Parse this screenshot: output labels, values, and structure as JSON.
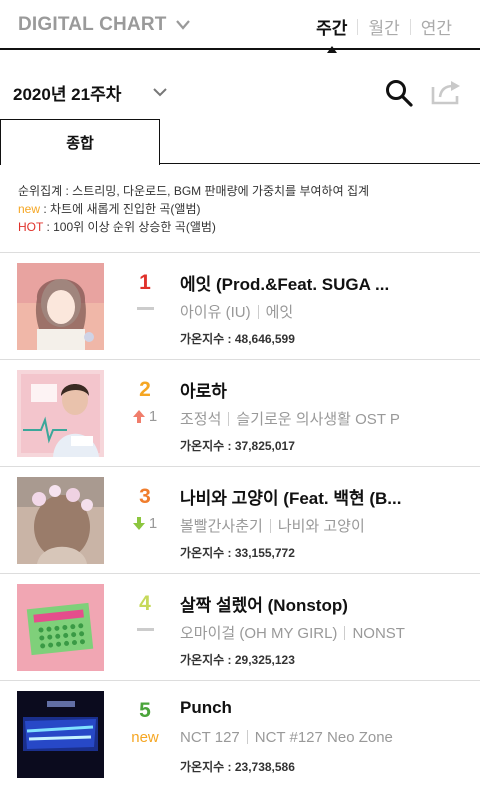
{
  "header": {
    "title": "DIGITAL CHART",
    "period_tabs": [
      {
        "label": "주간",
        "active": true
      },
      {
        "label": "월간",
        "active": false
      },
      {
        "label": "연간",
        "active": false
      }
    ]
  },
  "week_selector": {
    "label": "2020년 21주차"
  },
  "subtab": {
    "label": "종합"
  },
  "legend": {
    "line1": "순위집계 : 스트리밍, 다운로드, BGM 판매량에 가중치를 부여하여 집계",
    "new_key": "new",
    "new_desc": " : 차트에 새롭게 진입한 곡(앨범)",
    "hot_key": "HOT",
    "hot_desc": " : 100위 이상 순위 상승한 곡(앨범)"
  },
  "colors": {
    "rank1": "#e0322b",
    "rank2": "#f5a623",
    "rank3": "#f07d2c",
    "rank4": "#c6d95a",
    "rank5": "#4aa43a",
    "new": "#f5a623",
    "up": "#f07d6b",
    "down": "#8cc63f"
  },
  "chart": {
    "score_label": "가온지수 :",
    "entries": [
      {
        "rank": "1",
        "change_type": "same",
        "change": "",
        "title": "에잇 (Prod.&Feat. SUGA ...",
        "artist": "아이유 (IU)",
        "album": "에잇",
        "score": "48,646,599"
      },
      {
        "rank": "2",
        "change_type": "up",
        "change": "1",
        "title": "아로하",
        "artist": "조정석",
        "album": "슬기로운 의사생활 OST P",
        "score": "37,825,017"
      },
      {
        "rank": "3",
        "change_type": "down",
        "change": "1",
        "title": "나비와 고양이 (Feat. 백현 (B...",
        "artist": "볼빨간사춘기",
        "album": "나비와 고양이",
        "score": "33,155,772"
      },
      {
        "rank": "4",
        "change_type": "same",
        "change": "",
        "title": "살짝 설렜어 (Nonstop)",
        "artist": "오마이걸 (OH MY GIRL)",
        "album": "NONST",
        "score": "29,325,123"
      },
      {
        "rank": "5",
        "change_type": "new",
        "change": "new",
        "title": "Punch",
        "artist": "NCT 127",
        "album": "NCT #127 Neo Zone",
        "score": "23,738,586"
      }
    ]
  }
}
